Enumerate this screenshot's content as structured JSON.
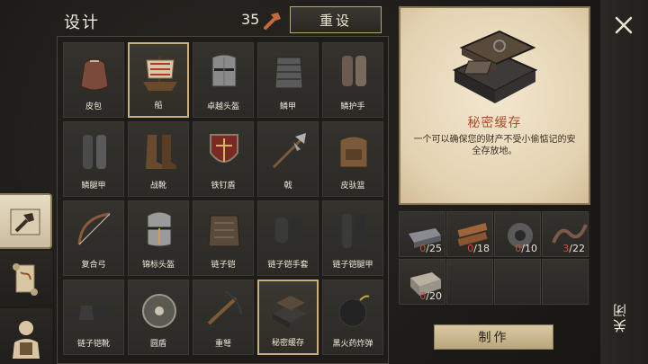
{
  "header": {
    "title": "设计",
    "resource_count": "35",
    "reset_label": "重设"
  },
  "tabs": [
    {
      "name": "blueprints-tab",
      "icon": "hammer-icon",
      "active": true
    },
    {
      "name": "scroll-tab",
      "icon": "scroll-icon",
      "active": false
    },
    {
      "name": "character-tab",
      "icon": "character-icon",
      "active": false
    }
  ],
  "items": [
    {
      "label": "皮包",
      "icon": "leather-bag-icon"
    },
    {
      "label": "船",
      "icon": "boat-icon",
      "selected": true
    },
    {
      "label": "卓越头盔",
      "icon": "great-helm-icon"
    },
    {
      "label": "鳞甲",
      "icon": "scale-armor-icon"
    },
    {
      "label": "鳞护手",
      "icon": "scale-gauntlet-icon"
    },
    {
      "label": "鳞腿甲",
      "icon": "scale-legs-icon"
    },
    {
      "label": "战靴",
      "icon": "war-boots-icon"
    },
    {
      "label": "铁钉盾",
      "icon": "studded-shield-icon"
    },
    {
      "label": "戟",
      "icon": "halberd-icon"
    },
    {
      "label": "皮驮篮",
      "icon": "leather-backpack-icon"
    },
    {
      "label": "复合弓",
      "icon": "composite-bow-icon"
    },
    {
      "label": "锦标头盔",
      "icon": "tournament-helm-icon"
    },
    {
      "label": "链子铠",
      "icon": "chainmail-icon"
    },
    {
      "label": "链子铠手套",
      "icon": "chain-gloves-icon"
    },
    {
      "label": "链子铠腿甲",
      "icon": "chain-legs-icon"
    },
    {
      "label": "链子铠靴",
      "icon": "chain-boots-icon"
    },
    {
      "label": "圆盾",
      "icon": "round-shield-icon"
    },
    {
      "label": "重弩",
      "icon": "heavy-crossbow-icon"
    },
    {
      "label": "秘密缓存",
      "icon": "secret-stash-icon",
      "selected": true
    },
    {
      "label": "黑火药炸弹",
      "icon": "bomb-icon"
    }
  ],
  "detail": {
    "name": "秘密缓存",
    "description": "一个可以确保您的财产不受小偷惦记的安全存放地。",
    "icon": "secret-stash-icon"
  },
  "materials": [
    {
      "icon": "iron-ingot-icon",
      "have": "0",
      "need": "/25"
    },
    {
      "icon": "wood-planks-icon",
      "have": "0",
      "need": "/18"
    },
    {
      "icon": "gear-icon",
      "have": "0",
      "need": "/10"
    },
    {
      "icon": "chain-icon",
      "have": "3",
      "need": "/22"
    },
    {
      "icon": "stone-block-icon",
      "have": "0",
      "need": "/20"
    }
  ],
  "actions": {
    "craft_label": "制作",
    "close_label": "关闭"
  },
  "colors": {
    "accent": "#c46a3a",
    "warning": "#d4493a",
    "selected_border": "#c9b07a"
  }
}
